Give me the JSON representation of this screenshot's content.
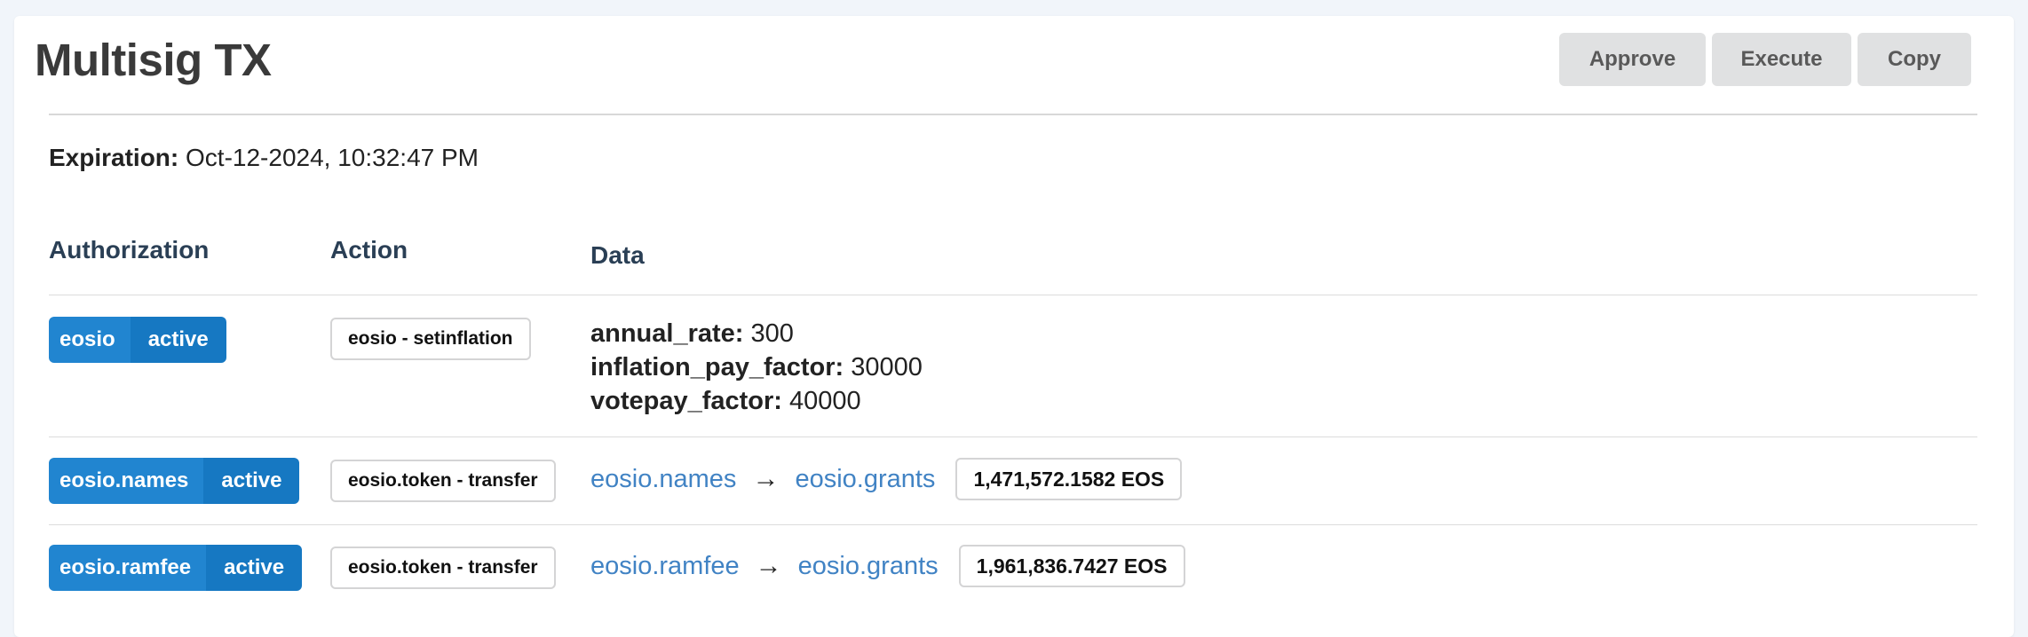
{
  "header": {
    "title": "Multisig TX",
    "buttons": {
      "approve": "Approve",
      "execute": "Execute",
      "copy": "Copy"
    }
  },
  "expiration": {
    "label": "Expiration:",
    "value": "Oct-12-2024, 10:32:47 PM"
  },
  "table": {
    "headers": {
      "authorization": "Authorization",
      "action": "Action",
      "data": "Data"
    },
    "rows": [
      {
        "auth_account": "eosio",
        "auth_permission": "active",
        "action": "eosio - setinflation",
        "data": [
          {
            "key": "annual_rate:",
            "value": "300"
          },
          {
            "key": "inflation_pay_factor:",
            "value": "30000"
          },
          {
            "key": "votepay_factor:",
            "value": "40000"
          }
        ]
      },
      {
        "auth_account": "eosio.names",
        "auth_permission": "active",
        "action": "eosio.token - transfer",
        "from": "eosio.names",
        "arrow": "→",
        "to": "eosio.grants",
        "amount": "1,471,572.1582 EOS"
      },
      {
        "auth_account": "eosio.ramfee",
        "auth_permission": "active",
        "action": "eosio.token - transfer",
        "from": "eosio.ramfee",
        "arrow": "→",
        "to": "eosio.grants",
        "amount": "1,961,836.7427 EOS"
      }
    ]
  },
  "colors": {
    "primary_blue": "#2185d0",
    "link_blue": "#4183c4",
    "button_gray": "#e0e1e2"
  }
}
